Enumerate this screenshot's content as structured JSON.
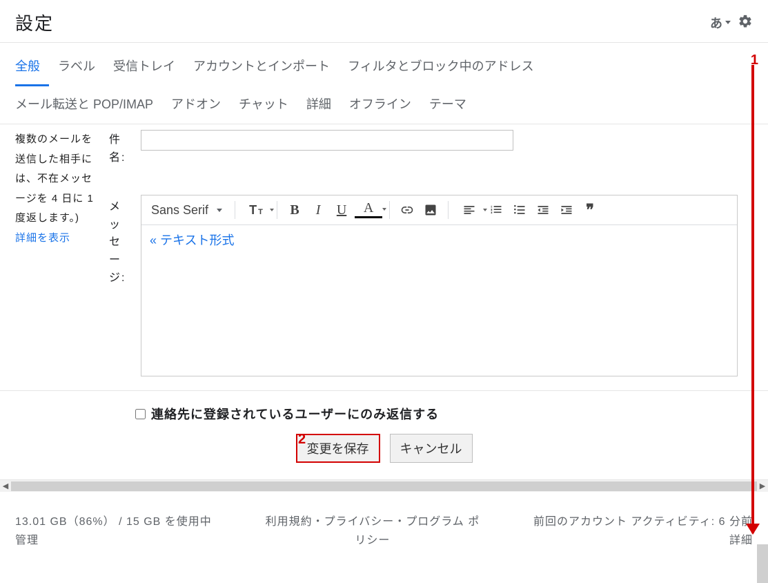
{
  "header": {
    "title": "設定",
    "language_label": "あ"
  },
  "tabs_row1": [
    {
      "label": "全般",
      "active": true
    },
    {
      "label": "ラベル"
    },
    {
      "label": "受信トレイ"
    },
    {
      "label": "アカウントとインポート"
    },
    {
      "label": "フィルタとブロック中のアドレス"
    }
  ],
  "tabs_row2": [
    {
      "label": "メール転送と POP/IMAP"
    },
    {
      "label": "アドオン"
    },
    {
      "label": "チャット"
    },
    {
      "label": "詳細"
    },
    {
      "label": "オフライン"
    },
    {
      "label": "テーマ"
    }
  ],
  "side": {
    "note": "複数のメールを送信した相手には、不在メッセージを 4 日に 1 度返します。)",
    "learn_more": "詳細を表示"
  },
  "labels": {
    "subject": "件名:",
    "message": "メッセージ:"
  },
  "editor": {
    "font_name": "Sans Serif",
    "plain_text_link": "テキスト形式",
    "quote_glyph": "❞"
  },
  "subject_value": "",
  "contacts_only_label": "連絡先に登録されているユーザーにのみ返信する",
  "contacts_only_checked": false,
  "buttons": {
    "save": "変更を保存",
    "cancel": "キャンセル"
  },
  "footer": {
    "left_line1": "13.01 GB（86%） / 15 GB を使用中",
    "left_line2": "管理",
    "center_line1": "利用規約・プライバシー・プログラム ポ",
    "center_line2": "リシー",
    "right_line1": "前回のアカウント アクティビティ: 6 分前",
    "right_line2": "詳細"
  },
  "annotations": {
    "one": "1",
    "two": "2"
  }
}
